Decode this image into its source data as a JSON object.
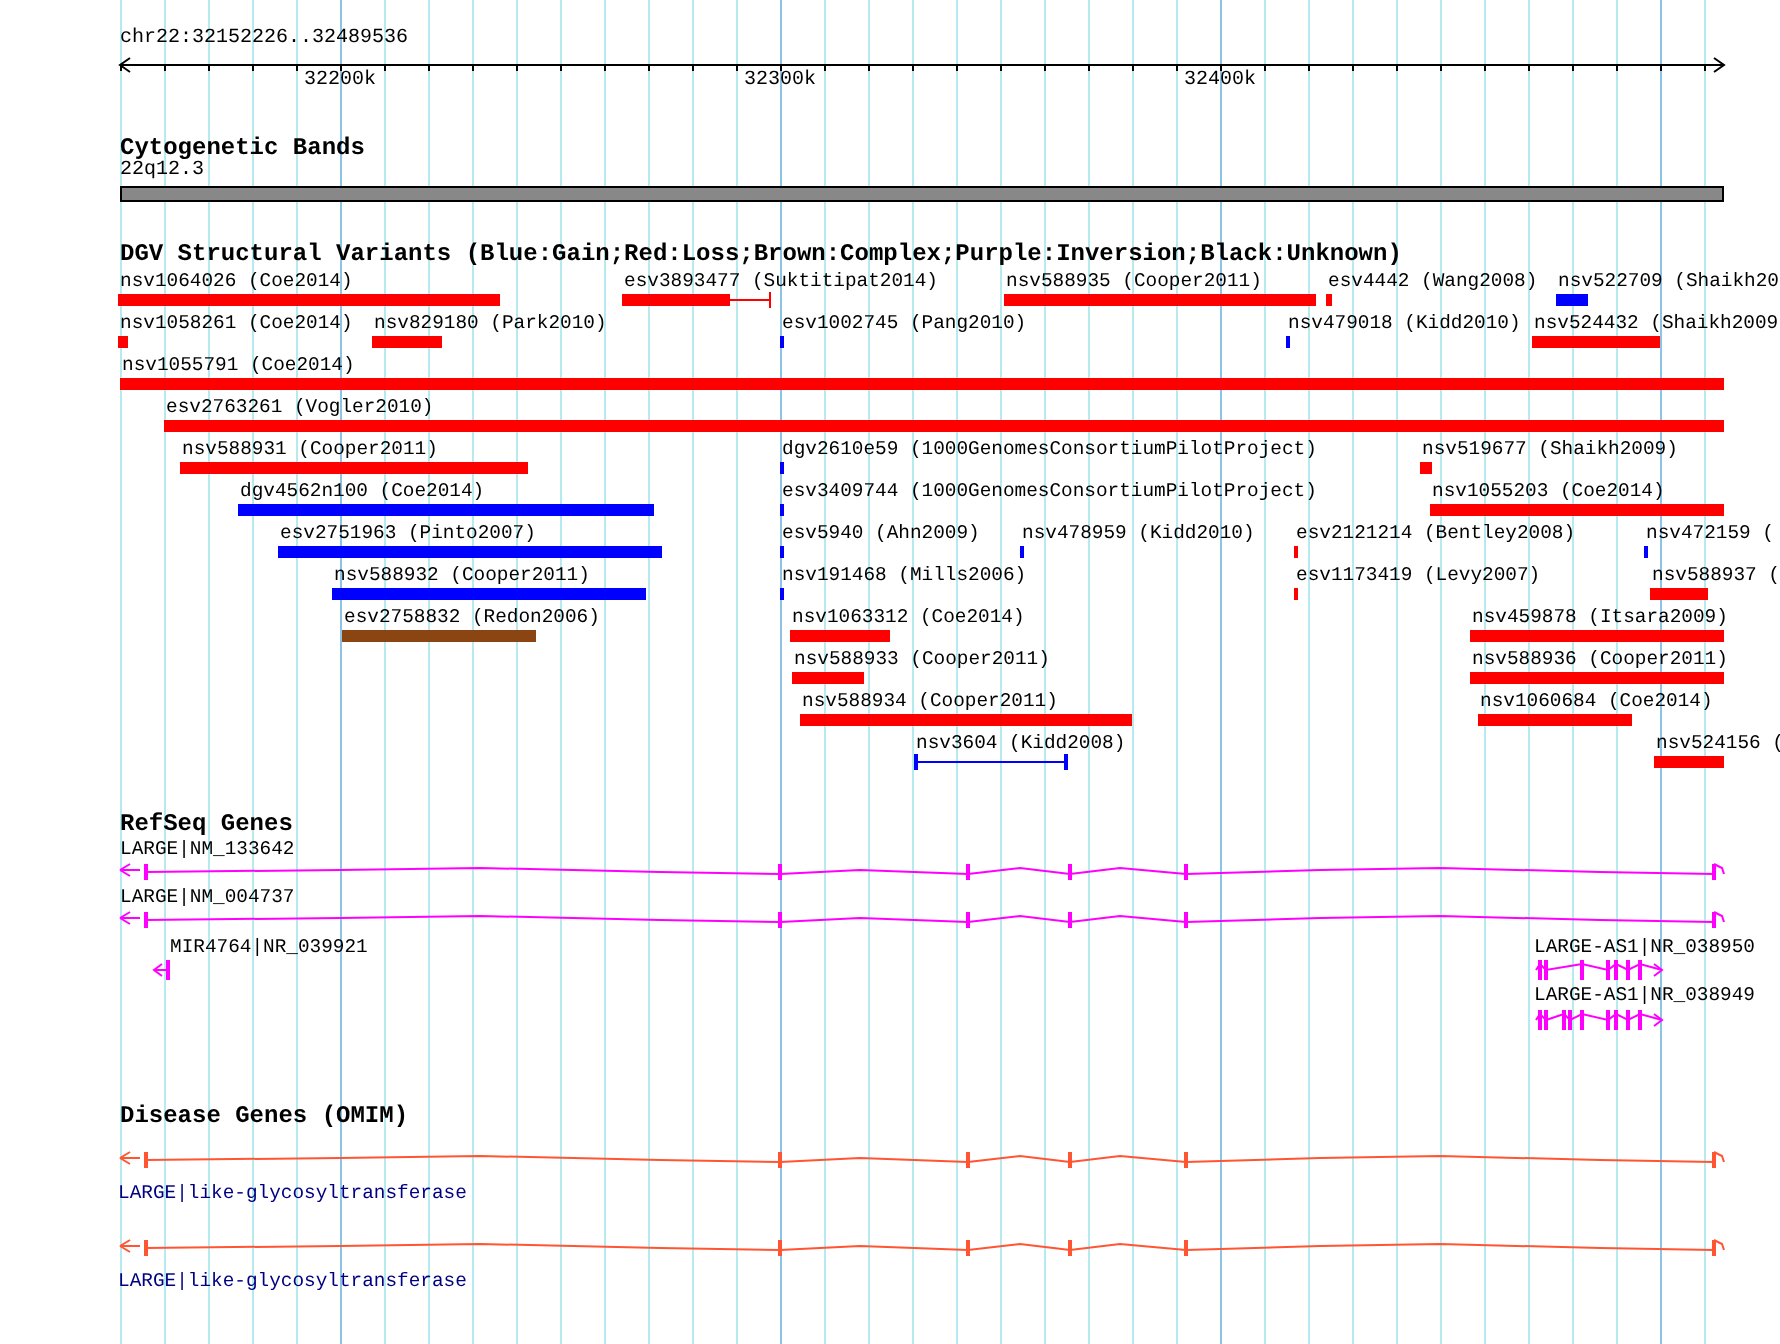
{
  "ruler": {
    "location": "chr22:32152226..32489536",
    "ticks": [
      "32200k",
      "32300k",
      "32400k"
    ]
  },
  "cytogenetic_bands": {
    "title": "Cytogenetic Bands",
    "band": "22q12.3"
  },
  "dgv": {
    "title": "DGV Structural Variants (Blue:Gain;Red:Loss;Brown:Complex;Purple:Inversion;Black:Unknown)",
    "variants": [
      {
        "label": "nsv1064026 (Coe2014)",
        "color": "#ff0000"
      },
      {
        "label": "esv3893477 (Suktitipat2014)",
        "color": "#ff0000"
      },
      {
        "label": "nsv588935 (Cooper2011)",
        "color": "#ff0000"
      },
      {
        "label": "esv4442 (Wang2008)",
        "color": "#ff0000"
      },
      {
        "label": "nsv522709 (Shaikh20",
        "color": "#0000ff"
      },
      {
        "label": "nsv1058261 (Coe2014)",
        "color": "#ff0000"
      },
      {
        "label": "nsv829180 (Park2010)",
        "color": "#ff0000"
      },
      {
        "label": "esv1002745 (Pang2010)",
        "color": "#0000ff"
      },
      {
        "label": "nsv479018 (Kidd2010)",
        "color": "#0000ff"
      },
      {
        "label": "nsv524432 (Shaikh2009",
        "color": "#ff0000"
      },
      {
        "label": "nsv1055791 (Coe2014)",
        "color": "#ff0000"
      },
      {
        "label": "esv2763261 (Vogler2010)",
        "color": "#ff0000"
      },
      {
        "label": "nsv588931 (Cooper2011)",
        "color": "#ff0000"
      },
      {
        "label": "dgv2610e59 (1000GenomesConsortiumPilotProject)",
        "color": "#0000ff"
      },
      {
        "label": "nsv519677 (Shaikh2009)",
        "color": "#ff0000"
      },
      {
        "label": "dgv4562n100 (Coe2014)",
        "color": "#0000ff"
      },
      {
        "label": "esv3409744 (1000GenomesConsortiumPilotProject)",
        "color": "#0000ff"
      },
      {
        "label": "nsv1055203 (Coe2014)",
        "color": "#ff0000"
      },
      {
        "label": "esv2751963 (Pinto2007)",
        "color": "#0000ff"
      },
      {
        "label": "esv5940 (Ahn2009)",
        "color": "#0000ff"
      },
      {
        "label": "nsv478959 (Kidd2010)",
        "color": "#0000ff"
      },
      {
        "label": "esv2121214 (Bentley2008)",
        "color": "#ff0000"
      },
      {
        "label": "nsv472159 (",
        "color": "#0000ff"
      },
      {
        "label": "nsv588932 (Cooper2011)",
        "color": "#0000ff"
      },
      {
        "label": "nsv191468 (Mills2006)",
        "color": "#0000ff"
      },
      {
        "label": "esv1173419 (Levy2007)",
        "color": "#ff0000"
      },
      {
        "label": "nsv588937 (",
        "color": "#ff0000"
      },
      {
        "label": "esv2758832 (Redon2006)",
        "color": "#8b4513"
      },
      {
        "label": "nsv1063312 (Coe2014)",
        "color": "#ff0000"
      },
      {
        "label": "nsv459878 (Itsara2009)",
        "color": "#ff0000"
      },
      {
        "label": "nsv588933 (Cooper2011)",
        "color": "#ff0000"
      },
      {
        "label": "nsv588936 (Cooper2011)",
        "color": "#ff0000"
      },
      {
        "label": "nsv588934 (Cooper2011)",
        "color": "#ff0000"
      },
      {
        "label": "nsv1060684 (Coe2014)",
        "color": "#ff0000"
      },
      {
        "label": "nsv3604 (Kidd2008)",
        "color": "#0000ff"
      },
      {
        "label": "nsv524156 (",
        "color": "#ff0000"
      }
    ]
  },
  "refseq": {
    "title": "RefSeq Genes",
    "genes": [
      {
        "label": "LARGE|NM_133642"
      },
      {
        "label": "LARGE|NM_004737"
      },
      {
        "label": "MIR4764|NR_039921"
      },
      {
        "label": "LARGE-AS1|NR_038950"
      },
      {
        "label": "LARGE-AS1|NR_038949"
      }
    ]
  },
  "omim": {
    "title": "Disease Genes (OMIM)",
    "genes": [
      {
        "label": "LARGE|like-glycosyltransferase"
      },
      {
        "label": "LARGE|like-glycosyltransferase"
      }
    ]
  }
}
